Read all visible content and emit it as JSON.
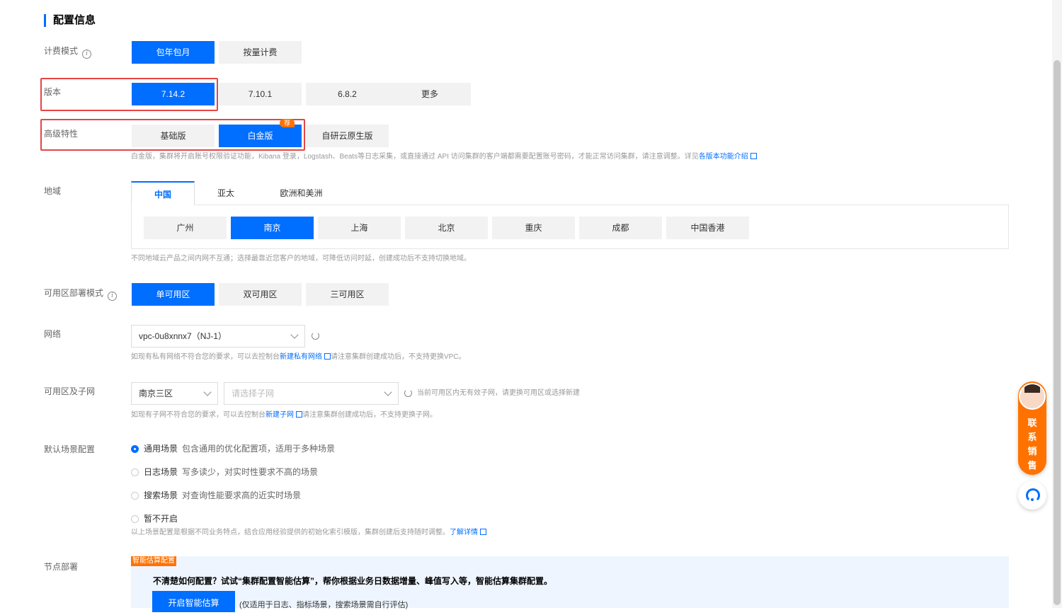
{
  "section_title": "配置信息",
  "billing": {
    "label": "计费模式",
    "options": [
      "包年包月",
      "按量计费"
    ]
  },
  "version": {
    "label": "版本",
    "options": [
      "7.14.2",
      "7.10.1",
      "6.8.2",
      "更多"
    ]
  },
  "advanced": {
    "label": "高级特性",
    "options": [
      "基础版",
      "白金版",
      "自研云原生版"
    ],
    "badge": "荐",
    "hint": "白金版，集群将开启账号权限验证功能，Kibana 登录，Logstash、Beats等日志采集，或直接通过 API 访问集群的客户端都需要配置账号密码，才能正常访问集群，请注意调整。详见",
    "hint_link": "各版本功能介绍"
  },
  "region": {
    "label": "地域",
    "tabs": [
      "中国",
      "亚太",
      "欧洲和美洲"
    ],
    "cities": [
      "广州",
      "南京",
      "上海",
      "北京",
      "重庆",
      "成都",
      "中国香港"
    ],
    "hint": "不同地域云产品之间内网不互通；选择最靠近您客户的地域，可降低访问时延，创建成功后不支持切换地域。"
  },
  "az_mode": {
    "label": "可用区部署模式",
    "options": [
      "单可用区",
      "双可用区",
      "三可用区"
    ]
  },
  "network": {
    "label": "网络",
    "vpc_value": "vpc-0u8xnnx7（NJ-1）",
    "hint_pre": "如现有私有网络不符合您的要求，可以去控制台",
    "hint_link": "新建私有网络",
    "hint_post": "请注意集群创建成功后，不支持更换VPC。"
  },
  "subnet": {
    "label": "可用区及子网",
    "zone_value": "南京三区",
    "subnet_placeholder": "请选择子网",
    "status": "当前可用区内无有效子网，请更换可用区或选择新建",
    "hint_pre": "如现有子网不符合您的要求，可以去控制台",
    "hint_link": "新建子网",
    "hint_post": "请注意集群创建成功后，不支持更换子网。"
  },
  "scene": {
    "label": "默认场景配置",
    "options": [
      {
        "name": "通用场景",
        "desc": "包含通用的优化配置项，适用于多种场景"
      },
      {
        "name": "日志场景",
        "desc": "写多读少，对实时性要求不高的场景"
      },
      {
        "name": "搜索场景",
        "desc": "对查询性能要求高的近实时场景"
      },
      {
        "name": "暂不开启",
        "desc": ""
      }
    ],
    "hint": "以上场景配置是根据不同业务特点，结合应用经验提供的初始化索引模版，集群创建后支持随时调整。",
    "hint_link": "了解详情"
  },
  "node": {
    "label": "节点部署",
    "badge": "智能估算配置",
    "promo": "不清楚如何配置？试试“集群配置智能估算”，帮你根据业务日数据增量、峰值写入等，智能估算集群配置。",
    "button": "开启智能估算",
    "note": "(仅适用于日志、指标场景，搜索场景需自行评估)"
  },
  "sales": {
    "text": "联系销售"
  },
  "colors": {
    "primary": "#006eff",
    "highlight_box": "#e54545",
    "badge": "#ff7200"
  }
}
